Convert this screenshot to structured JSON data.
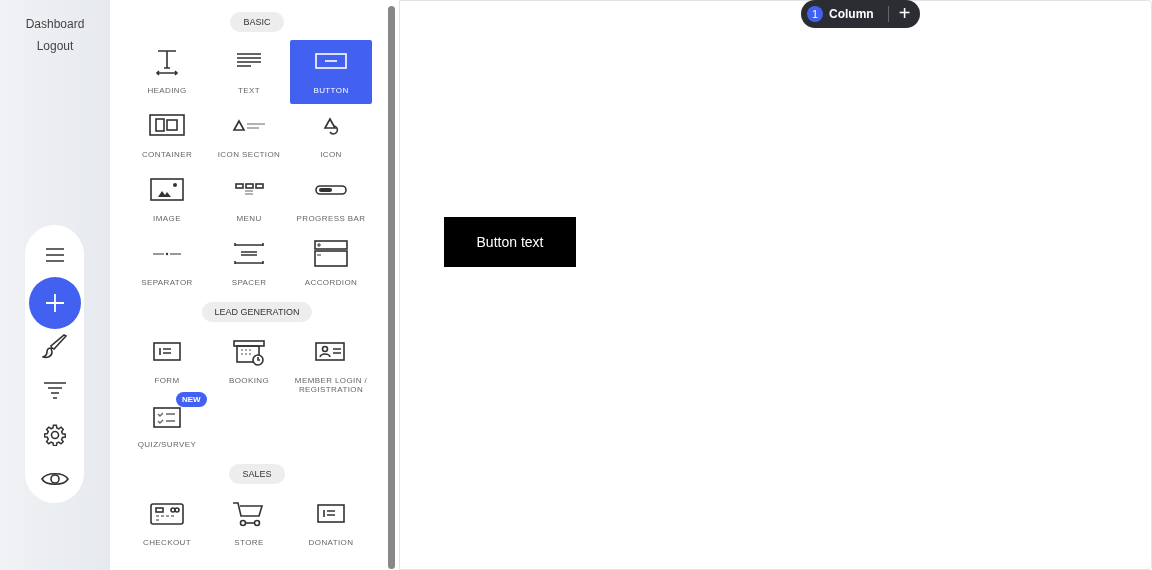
{
  "sidebar": {
    "links": [
      "Dashboard",
      "Logout"
    ]
  },
  "toolbar": [
    {
      "kind": "menu",
      "selected": false
    },
    {
      "kind": "add",
      "selected": true
    },
    {
      "kind": "brush",
      "selected": false
    },
    {
      "kind": "filter",
      "selected": false
    },
    {
      "kind": "settings",
      "selected": false
    },
    {
      "kind": "preview",
      "selected": false
    }
  ],
  "panel": {
    "sections": [
      {
        "title": "BASIC",
        "items": [
          {
            "kind": "heading",
            "label": "HEADING",
            "selected": false
          },
          {
            "kind": "text",
            "label": "TEXT",
            "selected": false
          },
          {
            "kind": "button",
            "label": "BUTTON",
            "selected": true
          },
          {
            "kind": "container",
            "label": "CONTAINER",
            "selected": false
          },
          {
            "kind": "iconsection",
            "label": "ICON SECTION",
            "selected": false
          },
          {
            "kind": "icon",
            "label": "ICON",
            "selected": false
          },
          {
            "kind": "image",
            "label": "IMAGE",
            "selected": false
          },
          {
            "kind": "menu",
            "label": "MENU",
            "selected": false
          },
          {
            "kind": "progress",
            "label": "PROGRESS BAR",
            "selected": false
          },
          {
            "kind": "separator",
            "label": "SEPARATOR",
            "selected": false
          },
          {
            "kind": "spacer",
            "label": "SPACER",
            "selected": false
          },
          {
            "kind": "accordion",
            "label": "ACCORDION",
            "selected": false
          }
        ]
      },
      {
        "title": "LEAD GENERATION",
        "items": [
          {
            "kind": "form",
            "label": "FORM",
            "selected": false
          },
          {
            "kind": "booking",
            "label": "BOOKING",
            "selected": false
          },
          {
            "kind": "member",
            "label": "MEMBER LOGIN / REGISTRATION",
            "selected": false
          },
          {
            "kind": "quiz",
            "label": "QUIZ/SURVEY",
            "selected": false,
            "badge": "NEW"
          }
        ]
      },
      {
        "title": "SALES",
        "items": [
          {
            "kind": "checkout",
            "label": "CHECKOUT",
            "selected": false
          },
          {
            "kind": "store",
            "label": "STORE",
            "selected": false
          },
          {
            "kind": "form",
            "label": "DONATION",
            "selected": false
          }
        ]
      }
    ]
  },
  "canvas": {
    "column_pill": {
      "count": "1",
      "label": "Column",
      "action": "+"
    },
    "button": {
      "label": "Button text"
    }
  }
}
